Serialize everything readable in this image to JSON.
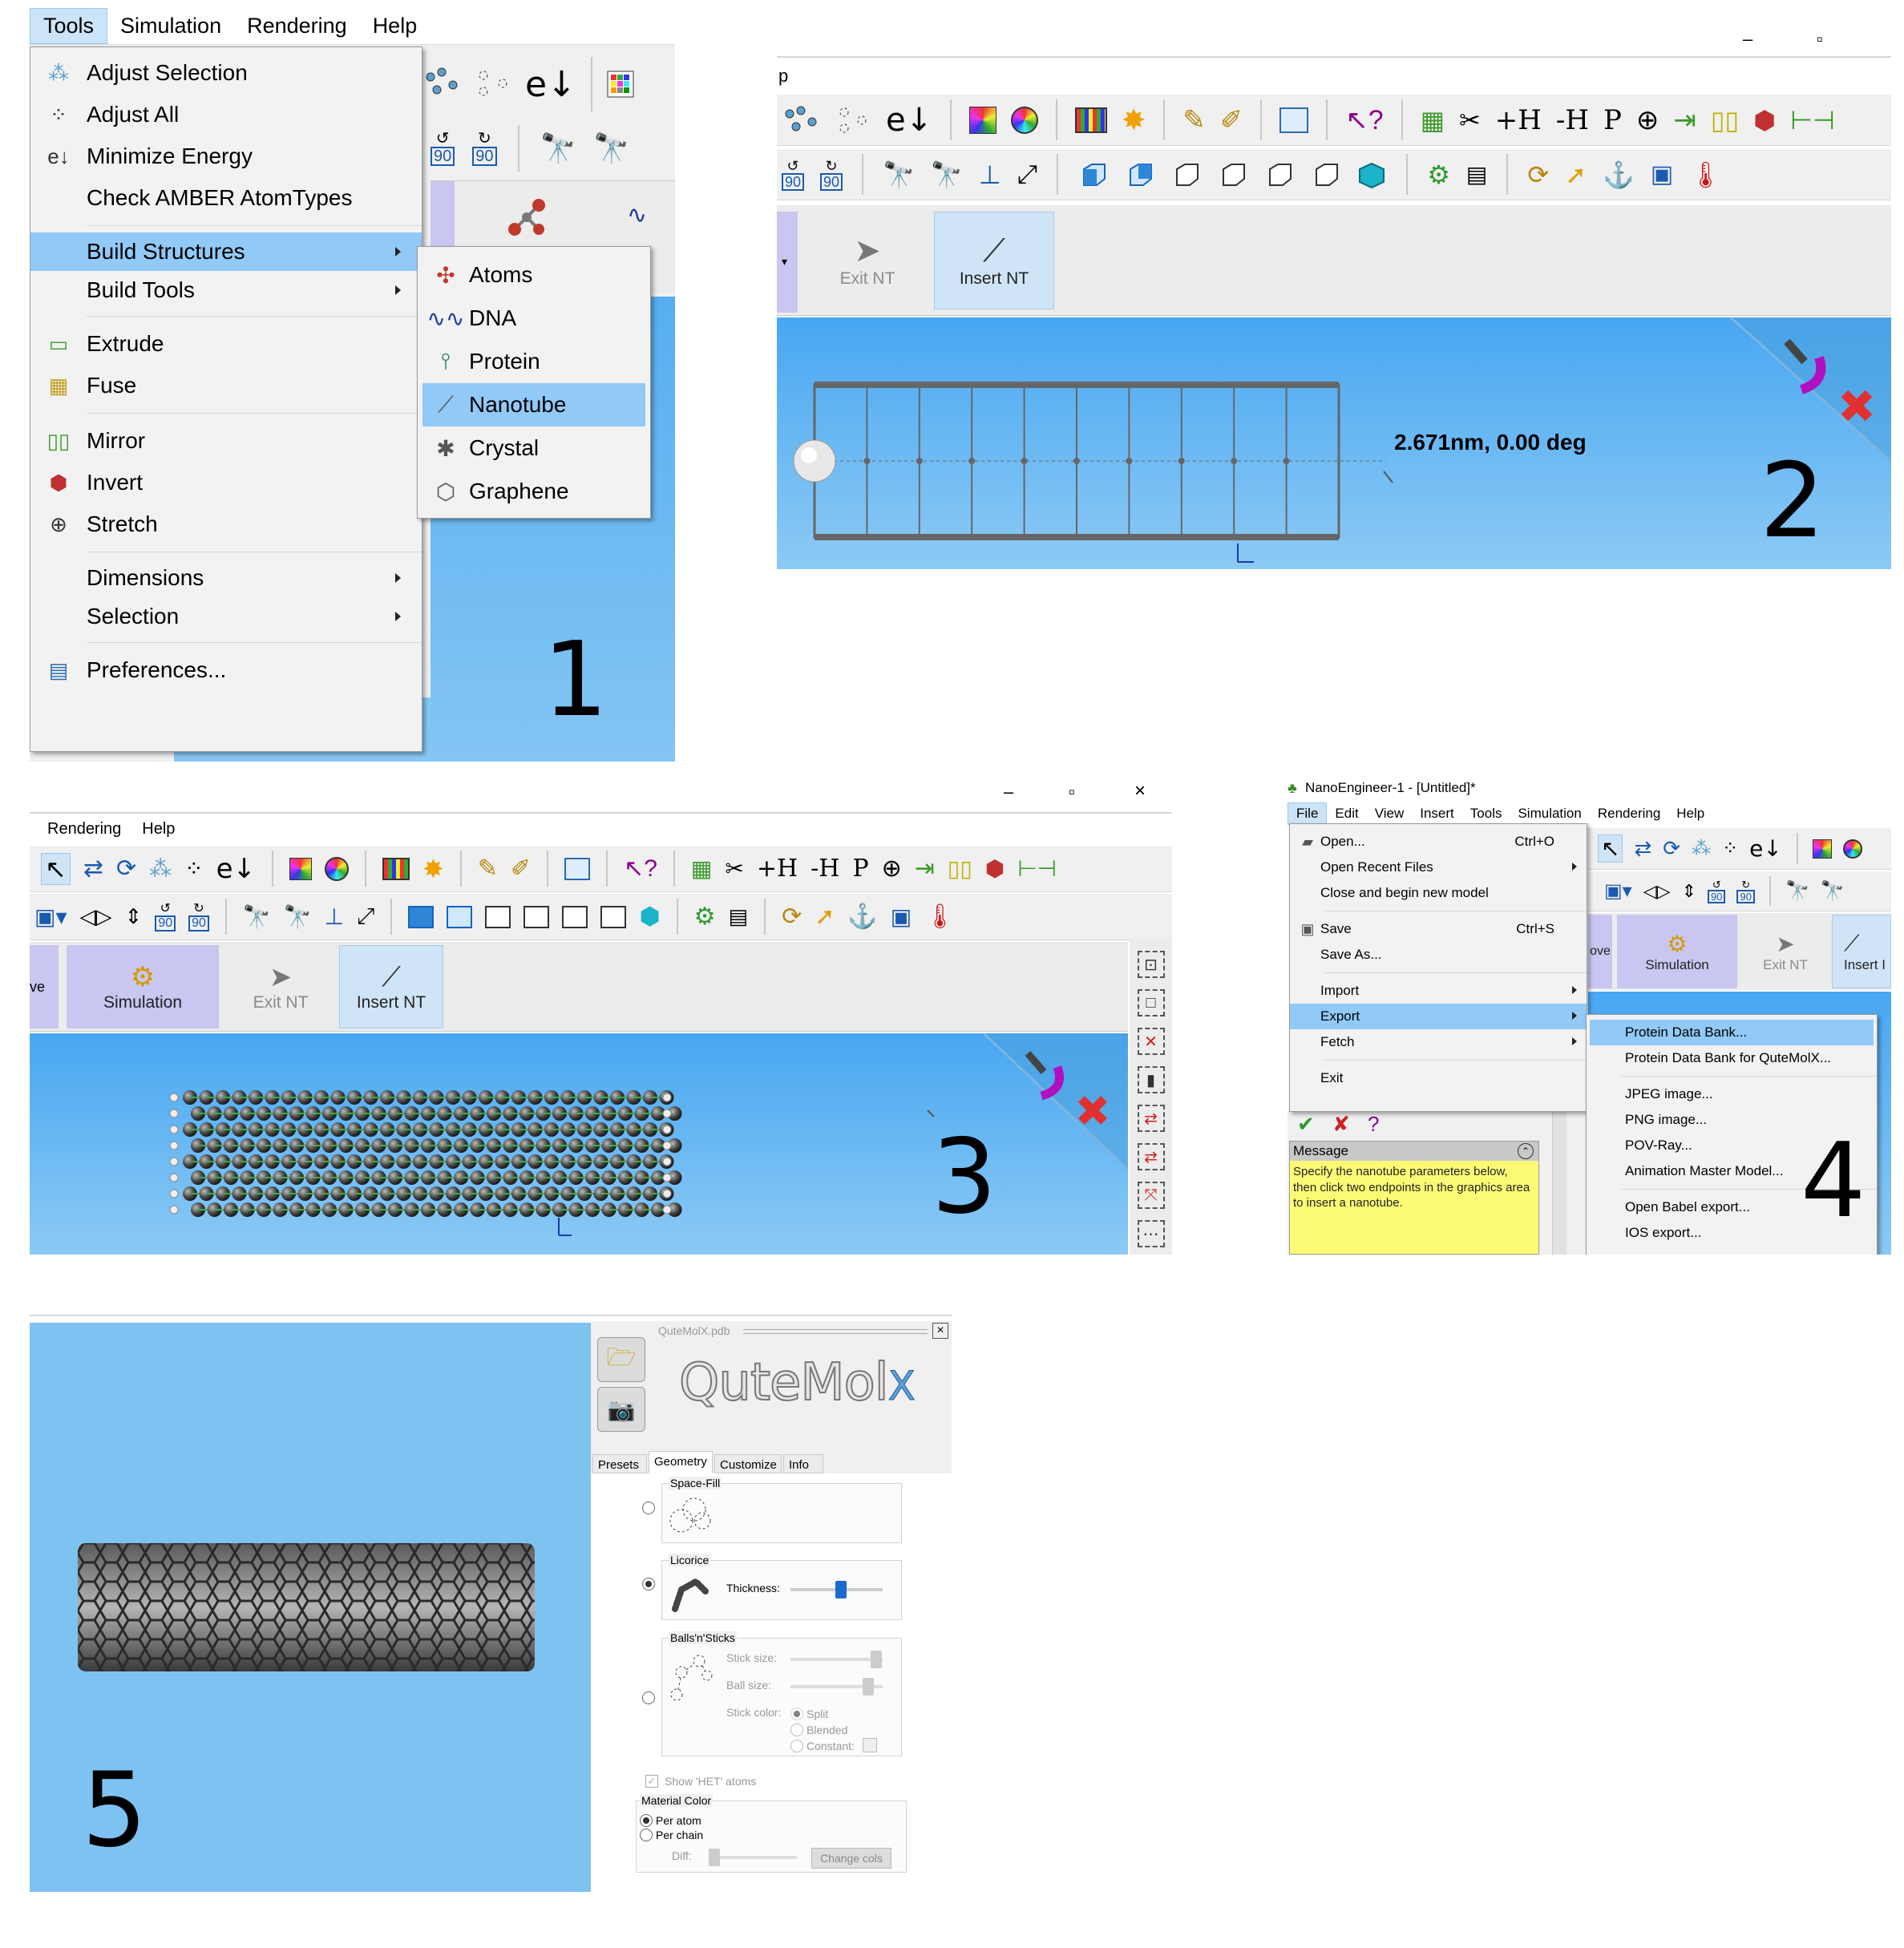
{
  "panel1": {
    "menubar": [
      "Tools",
      "Simulation",
      "Rendering",
      "Help"
    ],
    "tools_menu": [
      {
        "label": "Adjust Selection",
        "icon": "adjust-selection-icon"
      },
      {
        "label": "Adjust All",
        "icon": "adjust-all-icon"
      },
      {
        "label": "Minimize Energy",
        "icon": "minimize-energy-icon"
      },
      {
        "label": "Check AMBER AtomTypes",
        "icon": ""
      },
      {
        "label": "Build Structures",
        "icon": "",
        "submenu": true,
        "highlighted": true
      },
      {
        "label": "Build Tools",
        "icon": "",
        "submenu": true
      },
      {
        "label": "Extrude",
        "icon": "extrude-icon"
      },
      {
        "label": "Fuse",
        "icon": "fuse-icon"
      },
      {
        "label": "Mirror",
        "icon": "mirror-icon"
      },
      {
        "label": "Invert",
        "icon": "invert-icon"
      },
      {
        "label": "Stretch",
        "icon": "stretch-icon"
      },
      {
        "label": "Dimensions",
        "icon": "",
        "submenu": true
      },
      {
        "label": "Selection",
        "icon": "",
        "submenu": true
      },
      {
        "label": "Preferences...",
        "icon": "preferences-icon"
      }
    ],
    "build_submenu": [
      {
        "label": "Atoms",
        "icon": "atoms-icon"
      },
      {
        "label": "DNA",
        "icon": "dna-icon"
      },
      {
        "label": "Protein",
        "icon": "protein-icon"
      },
      {
        "label": "Nanotube",
        "icon": "nanotube-icon",
        "highlighted": true
      },
      {
        "label": "Crystal",
        "icon": "crystal-icon"
      },
      {
        "label": "Graphene",
        "icon": "graphene-icon"
      }
    ],
    "tb_90_a": "90",
    "tb_90_b": "90",
    "step": "1"
  },
  "panel2": {
    "title_fragment": "p",
    "window_controls": [
      "–",
      "▫"
    ],
    "exit_nt": "Exit NT",
    "insert_nt": "Insert NT",
    "measure": "2.671nm,  0.00 deg",
    "tb_90_a": "90",
    "tb_90_b": "90",
    "step": "2"
  },
  "panel3": {
    "menubar": [
      "Rendering",
      "Help"
    ],
    "window_controls": [
      "–",
      "▫",
      "×"
    ],
    "simulation": "Simulation",
    "exit_nt": "Exit NT",
    "insert_nt": "Insert NT",
    "move_fragment": "ve",
    "tb_90_a": "90",
    "tb_90_b": "90",
    "step": "3"
  },
  "panel4": {
    "title": "NanoEngineer-1 - [Untitled]*",
    "menubar": [
      "File",
      "Edit",
      "View",
      "Insert",
      "Tools",
      "Simulation",
      "Rendering",
      "Help"
    ],
    "file_menu": [
      {
        "label": "Open...",
        "shortcut": "Ctrl+O",
        "icon": "open-icon"
      },
      {
        "label": "Open Recent Files",
        "shortcut": "",
        "submenu": true
      },
      {
        "label": "Close and begin new model",
        "shortcut": ""
      },
      {
        "label": "Save",
        "shortcut": "Ctrl+S",
        "icon": "save-icon"
      },
      {
        "label": "Save As...",
        "shortcut": ""
      },
      {
        "label": "Import",
        "shortcut": "",
        "submenu": true
      },
      {
        "label": "Export",
        "shortcut": "",
        "submenu": true,
        "highlighted": true
      },
      {
        "label": "Fetch",
        "shortcut": "",
        "submenu": true
      },
      {
        "label": "Exit",
        "shortcut": ""
      }
    ],
    "export_submenu": [
      {
        "label": "Protein Data Bank...",
        "highlighted": true
      },
      {
        "label": "Protein Data Bank for QuteMolX..."
      },
      {
        "label": "JPEG image..."
      },
      {
        "label": "PNG image..."
      },
      {
        "label": "POV-Ray..."
      },
      {
        "label": "Animation Master Model..."
      },
      {
        "label": "Open Babel export..."
      },
      {
        "label": "IOS export..."
      }
    ],
    "message_title": "Message",
    "message_text": "Specify the nanotube parameters below, then click two endpoints in the graphics area to insert a nanotube.",
    "simulation": "Simulation",
    "exit_nt": "Exit NT",
    "insert_fragment": "Insert I",
    "move_fragment": "ove",
    "tb_90_a": "90",
    "tb_90_b": "90",
    "step": "4"
  },
  "panel5": {
    "window_title": "QuteMolX.pdb",
    "logo_text": "QuteMol",
    "logo_x": "X",
    "tabs": [
      "Presets",
      "Geometry",
      "Customize",
      "Info"
    ],
    "space_fill": "Space-Fill",
    "licorice": "Licorice",
    "thickness": "Thickness:",
    "balls_sticks": "Balls'n'Sticks",
    "stick_size": "Stick size:",
    "ball_size": "Ball size:",
    "stick_color": "Stick color:",
    "split": "Split",
    "blended": "Blended",
    "constant": "Constant:",
    "show_het": "Show 'HET' atoms",
    "material_color": "Material Color",
    "per_atom": "Per atom",
    "per_chain": "Per chain",
    "diff": "Diff:",
    "change_cols": "Change cols",
    "thickness_level": 0.55,
    "step": "5"
  }
}
